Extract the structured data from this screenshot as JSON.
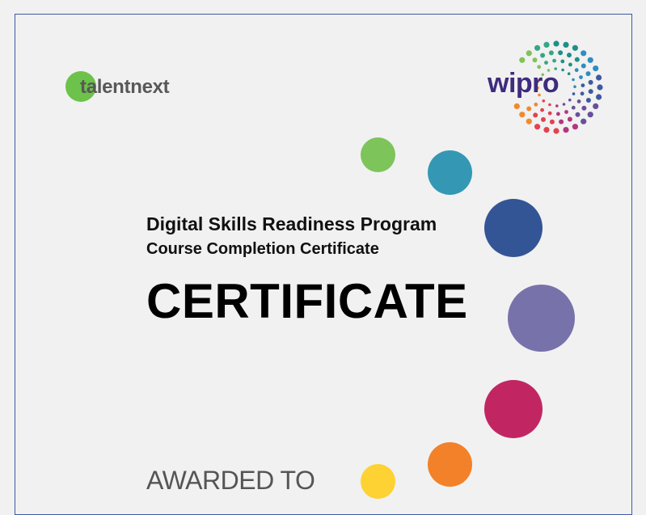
{
  "logos": {
    "talentnext": "talentnext",
    "wipro": "wipro"
  },
  "certificate": {
    "program_title": "Digital Skills Readiness Program",
    "course_title": "Course Completion Certificate",
    "heading": "CERTIFICATE",
    "awarded_to": "AWARDED TO"
  },
  "colors": {
    "frame_border": "#3d5aa0",
    "background": "#f1f1f1",
    "decor_circles": [
      "#7dc45a",
      "#3498b4",
      "#335596",
      "#7872ab",
      "#c12663",
      "#f28129",
      "#fdd232"
    ]
  }
}
